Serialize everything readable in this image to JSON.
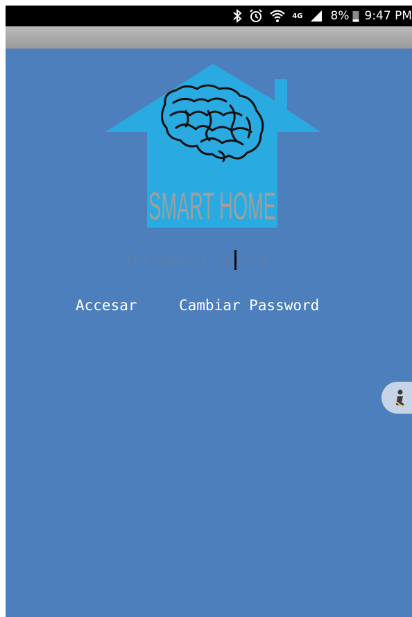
{
  "status_bar": {
    "network": "4G",
    "battery": "8%",
    "time": "9:47 PM"
  },
  "logo": {
    "text": "SMART HOME",
    "house_color": "#29abe2",
    "text_color": "#9e9e9e"
  },
  "login": {
    "password_placeholder": "Introducir contra",
    "login_label": "Accesar",
    "change_password_label": "Cambiar Password"
  },
  "colors": {
    "background": "#4d7fbd",
    "toolbar": "#a8a8a8",
    "status_bar": "#000000"
  }
}
